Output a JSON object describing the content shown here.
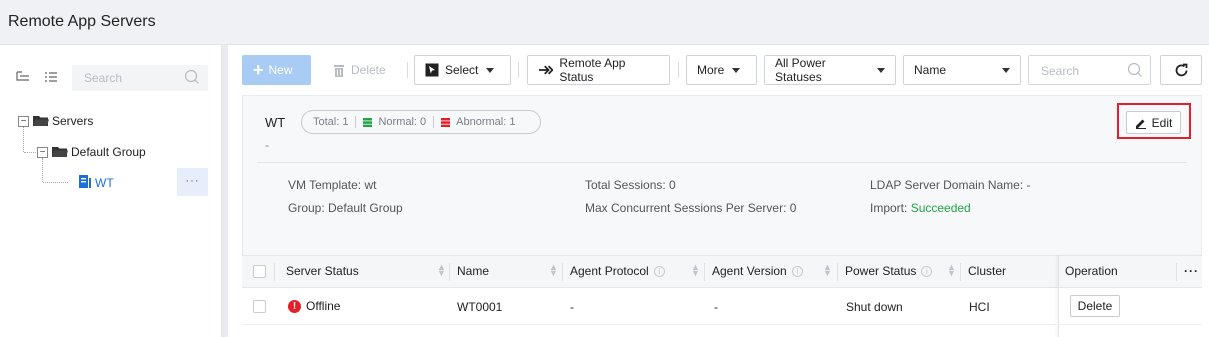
{
  "window": {
    "title": "Remote App Servers"
  },
  "sidebar": {
    "search_placeholder": "Search",
    "tree": [
      {
        "label": "Servers",
        "expanded": true
      },
      {
        "label": "Default Group",
        "expanded": true
      },
      {
        "label": "WT",
        "selected": true,
        "more_label": "···"
      }
    ]
  },
  "toolbar": {
    "new_label": "New",
    "delete_label": "Delete",
    "select_label": "Select",
    "remote_app_status_label": "Remote App Status",
    "more_label": "More",
    "power_filter_label": "All Power Statuses",
    "name_filter_label": "Name",
    "search_placeholder": "Search"
  },
  "detail": {
    "title": "WT",
    "subtitle": "-",
    "stats": {
      "total": "Total: 1",
      "normal": "Normal: 0",
      "abnormal": "Abnormal: 1"
    },
    "edit_label": "Edit",
    "fields": {
      "vm_template": "VM Template: wt",
      "group": "Group: Default Group",
      "total_sessions": "Total Sessions: 0",
      "max_sessions": "Max Concurrent Sessions Per Server: 0",
      "ldap": "LDAP Server Domain Name: -",
      "import_label": "Import: ",
      "import_value": "Succeeded"
    }
  },
  "table": {
    "headers": [
      "Server Status",
      "Name",
      "Agent Protocol",
      "Agent Version",
      "Power Status",
      "Cluster",
      "Operation"
    ],
    "more_label": "···",
    "rows": [
      {
        "status": "Offline",
        "name": "WT0001",
        "agent_protocol": "-",
        "agent_version": "-",
        "power_status": "Shut down",
        "cluster": "HCI",
        "operation": "Delete"
      }
    ]
  },
  "colors": {
    "accent": "#1f6fd6",
    "danger": "#e3202a",
    "success": "#22a447",
    "normal": "#22a447"
  }
}
